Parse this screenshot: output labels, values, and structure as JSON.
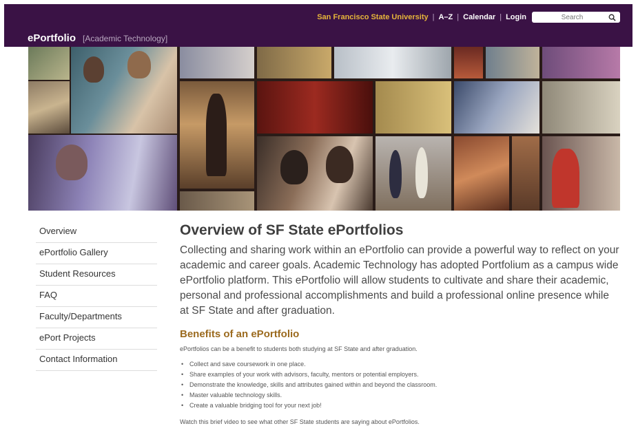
{
  "header": {
    "university_link": "San Francisco State University",
    "links": [
      "A–Z",
      "Calendar",
      "Login"
    ],
    "search_placeholder": "Search",
    "brand_name": "ePortfolio",
    "brand_unit": "[Academic Technology]",
    "background": "#3a1245",
    "university_color": "#e7b63a"
  },
  "sidebar": {
    "items": [
      {
        "label": "Overview"
      },
      {
        "label": "ePortfolio Gallery"
      },
      {
        "label": "Student Resources"
      },
      {
        "label": "FAQ"
      },
      {
        "label": "Faculty/Departments"
      },
      {
        "label": "ePort Projects"
      },
      {
        "label": "Contact Information"
      }
    ]
  },
  "main": {
    "title": "Overview of SF State ePortfolios",
    "intro": "Collecting and sharing work within an ePortfolio can provide a powerful way to reflect on your academic and career goals.  Academic Technology has adopted Portfolium as a campus wide ePortfolio platform.  This ePortfolio will allow students to cultivate and share their academic, personal and professional accomplishments and build a professional online presence while at SF State and after graduation.",
    "benefits_heading": "Benefits of an ePortfolio",
    "benefits_intro": "ePortfolios can be a benefit to students both studying at SF State and after graduation.",
    "benefits": [
      "Collect and save coursework in one place.",
      "Share examples of your work with advisors, faculty, mentors or potential employers.",
      "Demonstrate the knowledge, skills and attributes gained within and beyond the classroom.",
      "Master valuable technology skills.",
      "Create a valuable bridging tool for your next job!"
    ],
    "watch_text": "Watch this brief video to see what other SF State students are saying about ePortfolios."
  }
}
